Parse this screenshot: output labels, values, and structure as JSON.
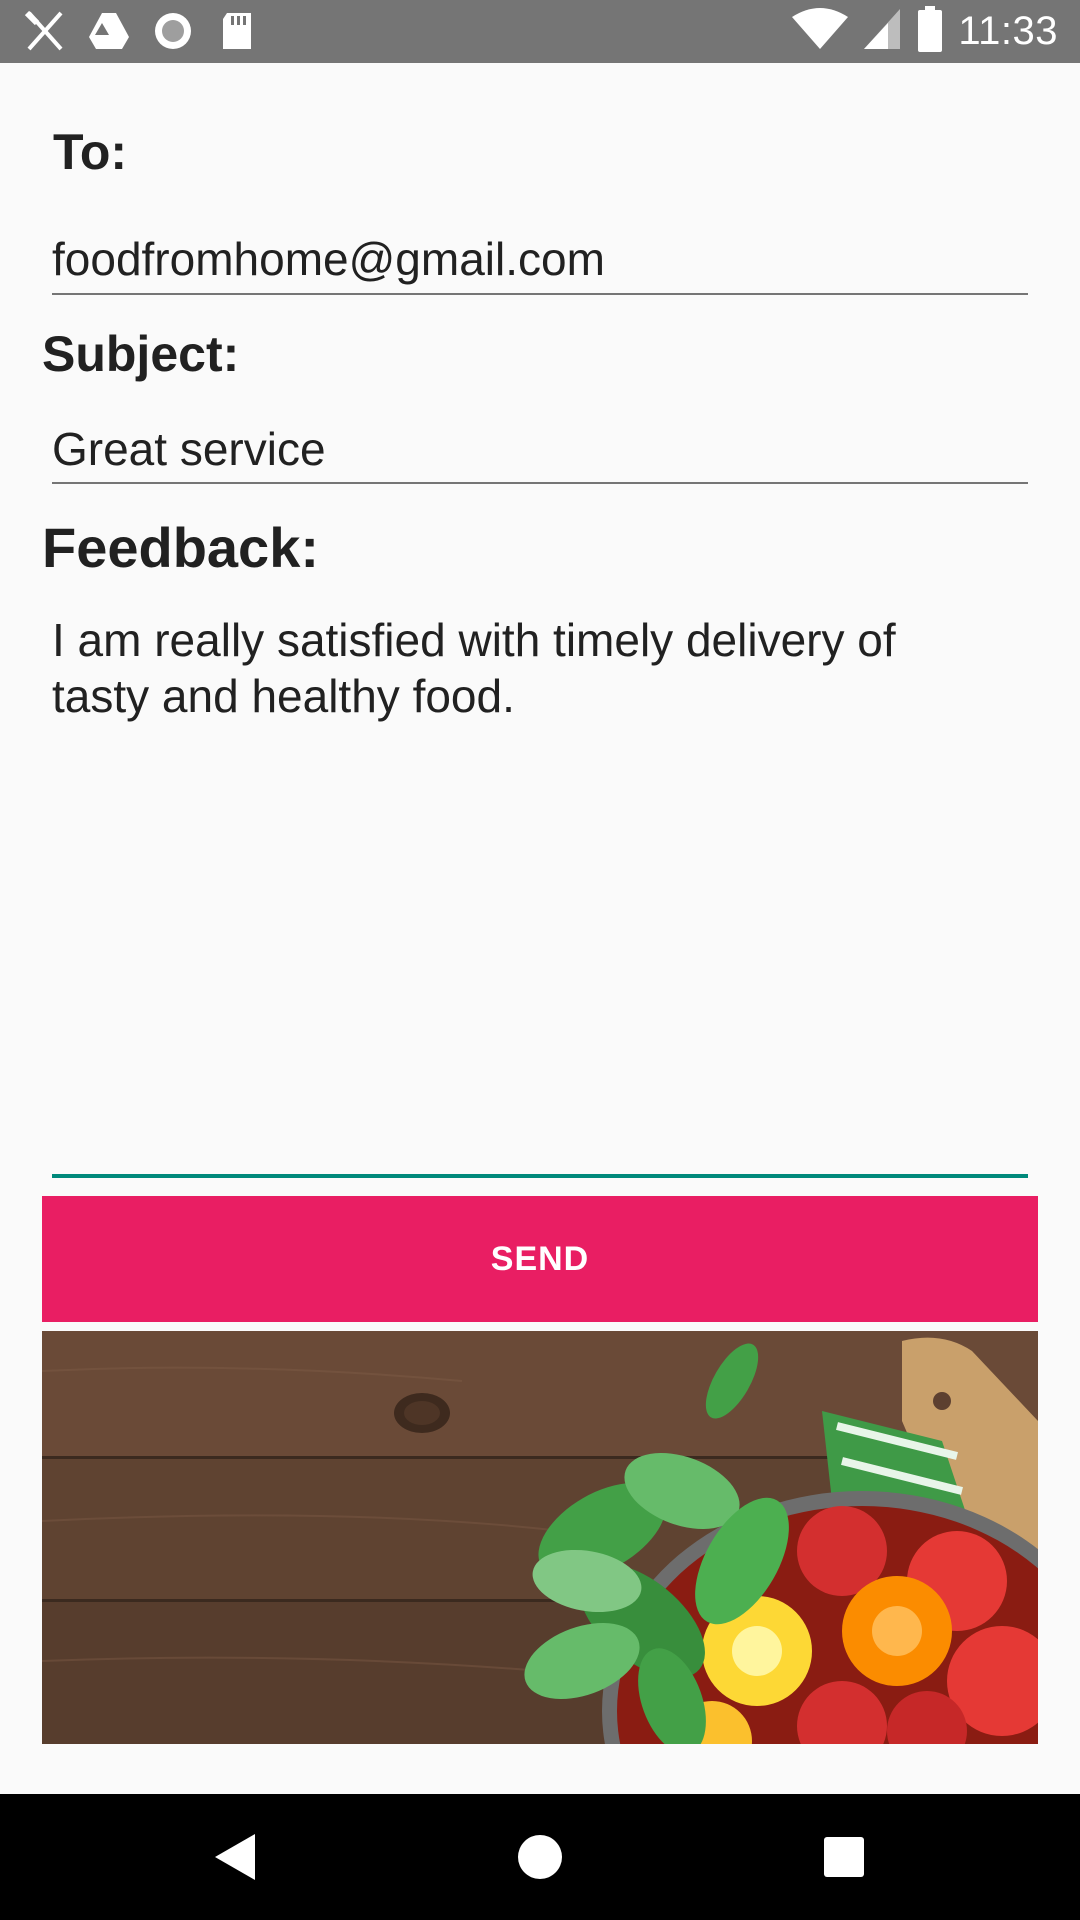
{
  "status_bar": {
    "time": "11:33",
    "left_icons": [
      "cutlery-icon",
      "drive-icon",
      "record-icon",
      "sd-card-icon"
    ],
    "right_icons": [
      "wifi-icon",
      "signal-icon",
      "battery-icon"
    ]
  },
  "form": {
    "to_label": "To:",
    "to_value": "foodfromhome@gmail.com",
    "subject_label": "Subject:",
    "subject_value": "Great service",
    "feedback_label": "Feedback:",
    "feedback_value": "I am really satisfied with timely delivery of tasty and healthy food.",
    "send_label": "SEND"
  },
  "banner": {
    "image": "food-banner-image"
  },
  "navbar": {
    "icons": [
      "back-icon",
      "home-icon",
      "recents-icon"
    ]
  },
  "colors": {
    "accent": "#e91e63",
    "focus_underline": "#00897b",
    "status_bar": "#757575"
  }
}
